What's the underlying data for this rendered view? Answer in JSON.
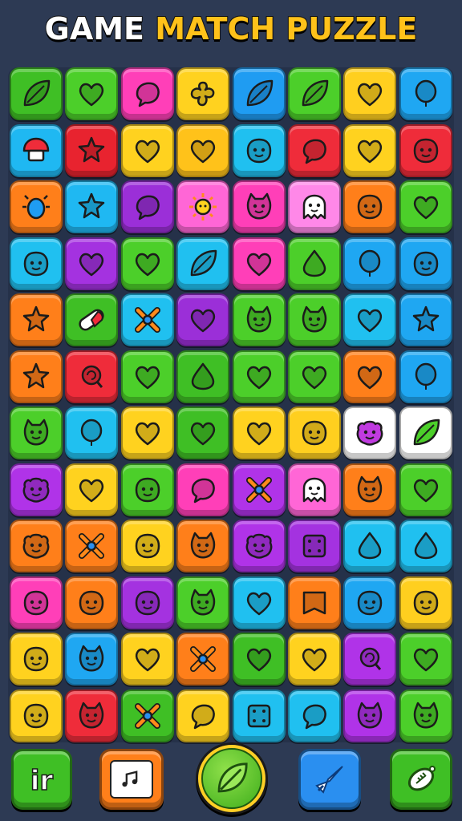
{
  "title": {
    "word1": "GAME",
    "word2": "MATCH PUZZLE"
  },
  "board": {
    "rows": [
      [
        [
          "#3fbf25",
          "leaf"
        ],
        [
          "#4ccf2a",
          "heart"
        ],
        [
          "#ff3fb8",
          "blob"
        ],
        [
          "#ffd21f",
          "clover"
        ],
        [
          "#1f9cf2",
          "leaf"
        ],
        [
          "#4ccf2a",
          "leaf"
        ],
        [
          "#ffcf1f",
          "heart"
        ],
        [
          "#1fa7f2",
          "balloon"
        ]
      ],
      [
        [
          "#1fb8f2",
          "mushroom"
        ],
        [
          "#e8232f",
          "star"
        ],
        [
          "#ffd21f",
          "heart"
        ],
        [
          "#ffc21a",
          "heart"
        ],
        [
          "#20c0f0",
          "face"
        ],
        [
          "#ef2c3a",
          "blob"
        ],
        [
          "#ffd21f",
          "heart"
        ],
        [
          "#ef2c3a",
          "face"
        ]
      ],
      [
        [
          "#ff7f1a",
          "bug"
        ],
        [
          "#1fb8f2",
          "star"
        ],
        [
          "#9b2fd8",
          "blob"
        ],
        [
          "#ff66d6",
          "sun"
        ],
        [
          "#ff3fb8",
          "cat"
        ],
        [
          "#ff88e8",
          "ghost"
        ],
        [
          "#ff7f1a",
          "face"
        ],
        [
          "#4ccf2a",
          "heart"
        ]
      ],
      [
        [
          "#20c0f0",
          "face"
        ],
        [
          "#a432e0",
          "heart"
        ],
        [
          "#4ccf2a",
          "heart"
        ],
        [
          "#20c0f0",
          "leaf"
        ],
        [
          "#ff3fb8",
          "heart"
        ],
        [
          "#4ccf2a",
          "drop"
        ],
        [
          "#1fa7f2",
          "balloon"
        ],
        [
          "#1fa7f2",
          "face"
        ]
      ],
      [
        [
          "#ff7f1a",
          "star"
        ],
        [
          "#3fbf25",
          "pill"
        ],
        [
          "#20c0f0",
          "cross"
        ],
        [
          "#9b2fd8",
          "heart"
        ],
        [
          "#4ccf2a",
          "cat"
        ],
        [
          "#4ccf2a",
          "cat"
        ],
        [
          "#20c0f0",
          "heart"
        ],
        [
          "#1fa7f2",
          "star"
        ]
      ],
      [
        [
          "#ff7f1a",
          "star"
        ],
        [
          "#ef2c3a",
          "candy"
        ],
        [
          "#4ccf2a",
          "heart"
        ],
        [
          "#3fbf25",
          "drop"
        ],
        [
          "#4ccf2a",
          "heart"
        ],
        [
          "#4ccf2a",
          "heart"
        ],
        [
          "#ff7f1a",
          "heart"
        ],
        [
          "#1fa7f2",
          "balloon"
        ]
      ],
      [
        [
          "#4ccf2a",
          "cat"
        ],
        [
          "#20c0f0",
          "balloon"
        ],
        [
          "#ffd21f",
          "heart"
        ],
        [
          "#3fbf25",
          "heart"
        ],
        [
          "#ffd21f",
          "heart"
        ],
        [
          "#ffcf1f",
          "face"
        ],
        [
          "#ffffff",
          "monster"
        ],
        [
          "#ffffff",
          "leaf"
        ]
      ],
      [
        [
          "#b033e8",
          "monster"
        ],
        [
          "#ffd21f",
          "heart"
        ],
        [
          "#4ccf2a",
          "face"
        ],
        [
          "#ff3fb8",
          "blob"
        ],
        [
          "#b033e8",
          "cross"
        ],
        [
          "#ff66d6",
          "ghost"
        ],
        [
          "#ff7f1a",
          "cat"
        ],
        [
          "#4ccf2a",
          "heart"
        ]
      ],
      [
        [
          "#ff7f1a",
          "monster"
        ],
        [
          "#ff7f1a",
          "cross"
        ],
        [
          "#ffd21f",
          "face"
        ],
        [
          "#ff7f1a",
          "cat"
        ],
        [
          "#b033e8",
          "monster"
        ],
        [
          "#a432e0",
          "dice"
        ],
        [
          "#20c0f0",
          "drop"
        ],
        [
          "#20c0f0",
          "drop"
        ]
      ],
      [
        [
          "#ff3fb8",
          "face"
        ],
        [
          "#ff7f1a",
          "face"
        ],
        [
          "#a432e0",
          "face"
        ],
        [
          "#4ccf2a",
          "cat"
        ],
        [
          "#20c0f0",
          "heart"
        ],
        [
          "#ff7f1a",
          "square"
        ],
        [
          "#1fa7f2",
          "face"
        ],
        [
          "#ffcf1f",
          "face"
        ]
      ],
      [
        [
          "#ffd21f",
          "face"
        ],
        [
          "#1fa7f2",
          "cat"
        ],
        [
          "#ffd21f",
          "heart"
        ],
        [
          "#ff7f1a",
          "cross"
        ],
        [
          "#3fbf25",
          "heart"
        ],
        [
          "#ffd21f",
          "heart"
        ],
        [
          "#b033e8",
          "candy"
        ],
        [
          "#4ccf2a",
          "heart"
        ]
      ],
      [
        [
          "#ffd21f",
          "face"
        ],
        [
          "#ef2c3a",
          "cat"
        ],
        [
          "#3fbf25",
          "cross"
        ],
        [
          "#ffd21f",
          "blob"
        ],
        [
          "#20c0f0",
          "dice"
        ],
        [
          "#20c0f0",
          "blob"
        ],
        [
          "#b033e8",
          "cat"
        ],
        [
          "#4ccf2a",
          "cat"
        ]
      ]
    ]
  },
  "toolbar": {
    "left": {
      "icon": "ir-text-icon",
      "label": "ir"
    },
    "second": {
      "icon": "music-note-icon"
    },
    "center": {
      "icon": "leaf-icon"
    },
    "fourth": {
      "icon": "rocket-icon"
    },
    "right": {
      "icon": "football-icon"
    }
  },
  "colors": {
    "background": "#2d3a54",
    "title_accent": "#ffc21a"
  }
}
